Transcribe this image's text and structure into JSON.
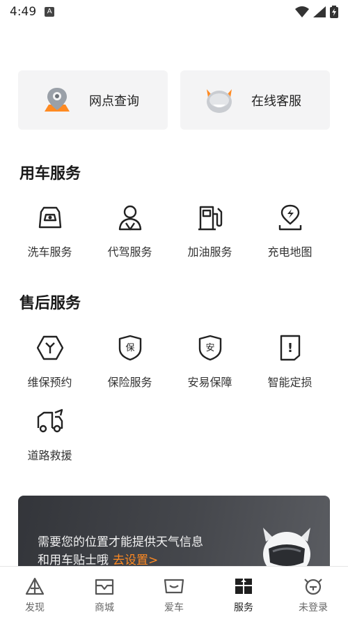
{
  "status_bar": {
    "time": "4:49",
    "notification_icon": "a-icon",
    "icons": [
      "wifi-icon",
      "signal-icon",
      "battery-charging-icon"
    ]
  },
  "quick_actions": [
    {
      "label": "网点查询",
      "icon": "location-pin-icon"
    },
    {
      "label": "在线客服",
      "icon": "mascot-icon"
    }
  ],
  "sections": {
    "car_services": {
      "title": "用车服务",
      "items": [
        {
          "label": "洗车服务",
          "icon": "car-wash-icon"
        },
        {
          "label": "代驾服务",
          "icon": "driver-icon"
        },
        {
          "label": "加油服务",
          "icon": "fuel-pump-icon"
        },
        {
          "label": "充电地图",
          "icon": "charging-map-icon"
        }
      ]
    },
    "after_sales": {
      "title": "售后服务",
      "items": [
        {
          "label": "维保预约",
          "icon": "wrench-icon"
        },
        {
          "label": "保险服务",
          "icon": "insurance-shield-icon",
          "glyph": "保"
        },
        {
          "label": "安易保障",
          "icon": "safety-shield-icon",
          "glyph": "安"
        },
        {
          "label": "智能定损",
          "icon": "damage-assess-icon",
          "glyph": "!"
        },
        {
          "label": "道路救援",
          "icon": "tow-truck-icon"
        }
      ]
    }
  },
  "weather_banner": {
    "line1": "需要您的位置才能提供天气信息",
    "line2": "和用车贴士哦",
    "link": "去设置>"
  },
  "tab_bar": [
    {
      "label": "发现",
      "icon": "discover-icon",
      "active": false
    },
    {
      "label": "商城",
      "icon": "shop-icon",
      "active": false
    },
    {
      "label": "爱车",
      "icon": "my-car-icon",
      "active": false
    },
    {
      "label": "服务",
      "icon": "service-icon",
      "active": true
    },
    {
      "label": "未登录",
      "icon": "profile-icon",
      "active": false
    }
  ],
  "colors": {
    "accent": "#ff8a22",
    "card_bg": "#f4f4f5",
    "banner_bg": "#3a3c41",
    "text": "#1f1f1f"
  }
}
